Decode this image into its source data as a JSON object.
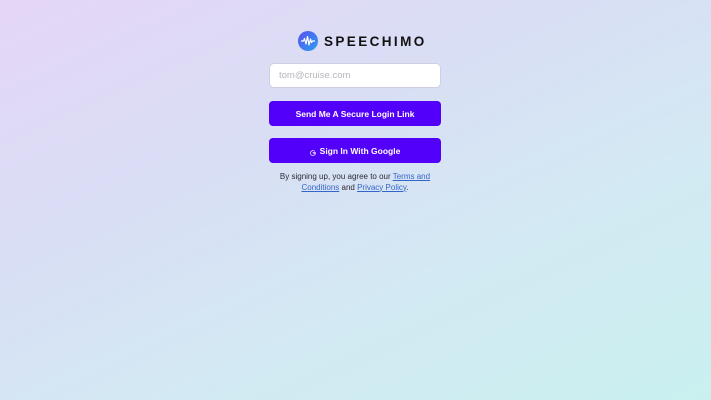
{
  "brand": {
    "name": "SPEECHIMO",
    "logo_icon": "soundwave-icon",
    "accent": "#5300fa"
  },
  "form": {
    "email_placeholder": "tom@cruise.com",
    "email_value": "",
    "send_link_label": "Send Me A Secure Login Link",
    "google_label": "Sign In With Google",
    "google_icon": "google-icon"
  },
  "terms": {
    "prefix": "By signing up, you agree to our ",
    "terms_link": "Terms and Conditions",
    "conjunction": " and ",
    "privacy_link": "Privacy Policy",
    "suffix": "."
  }
}
